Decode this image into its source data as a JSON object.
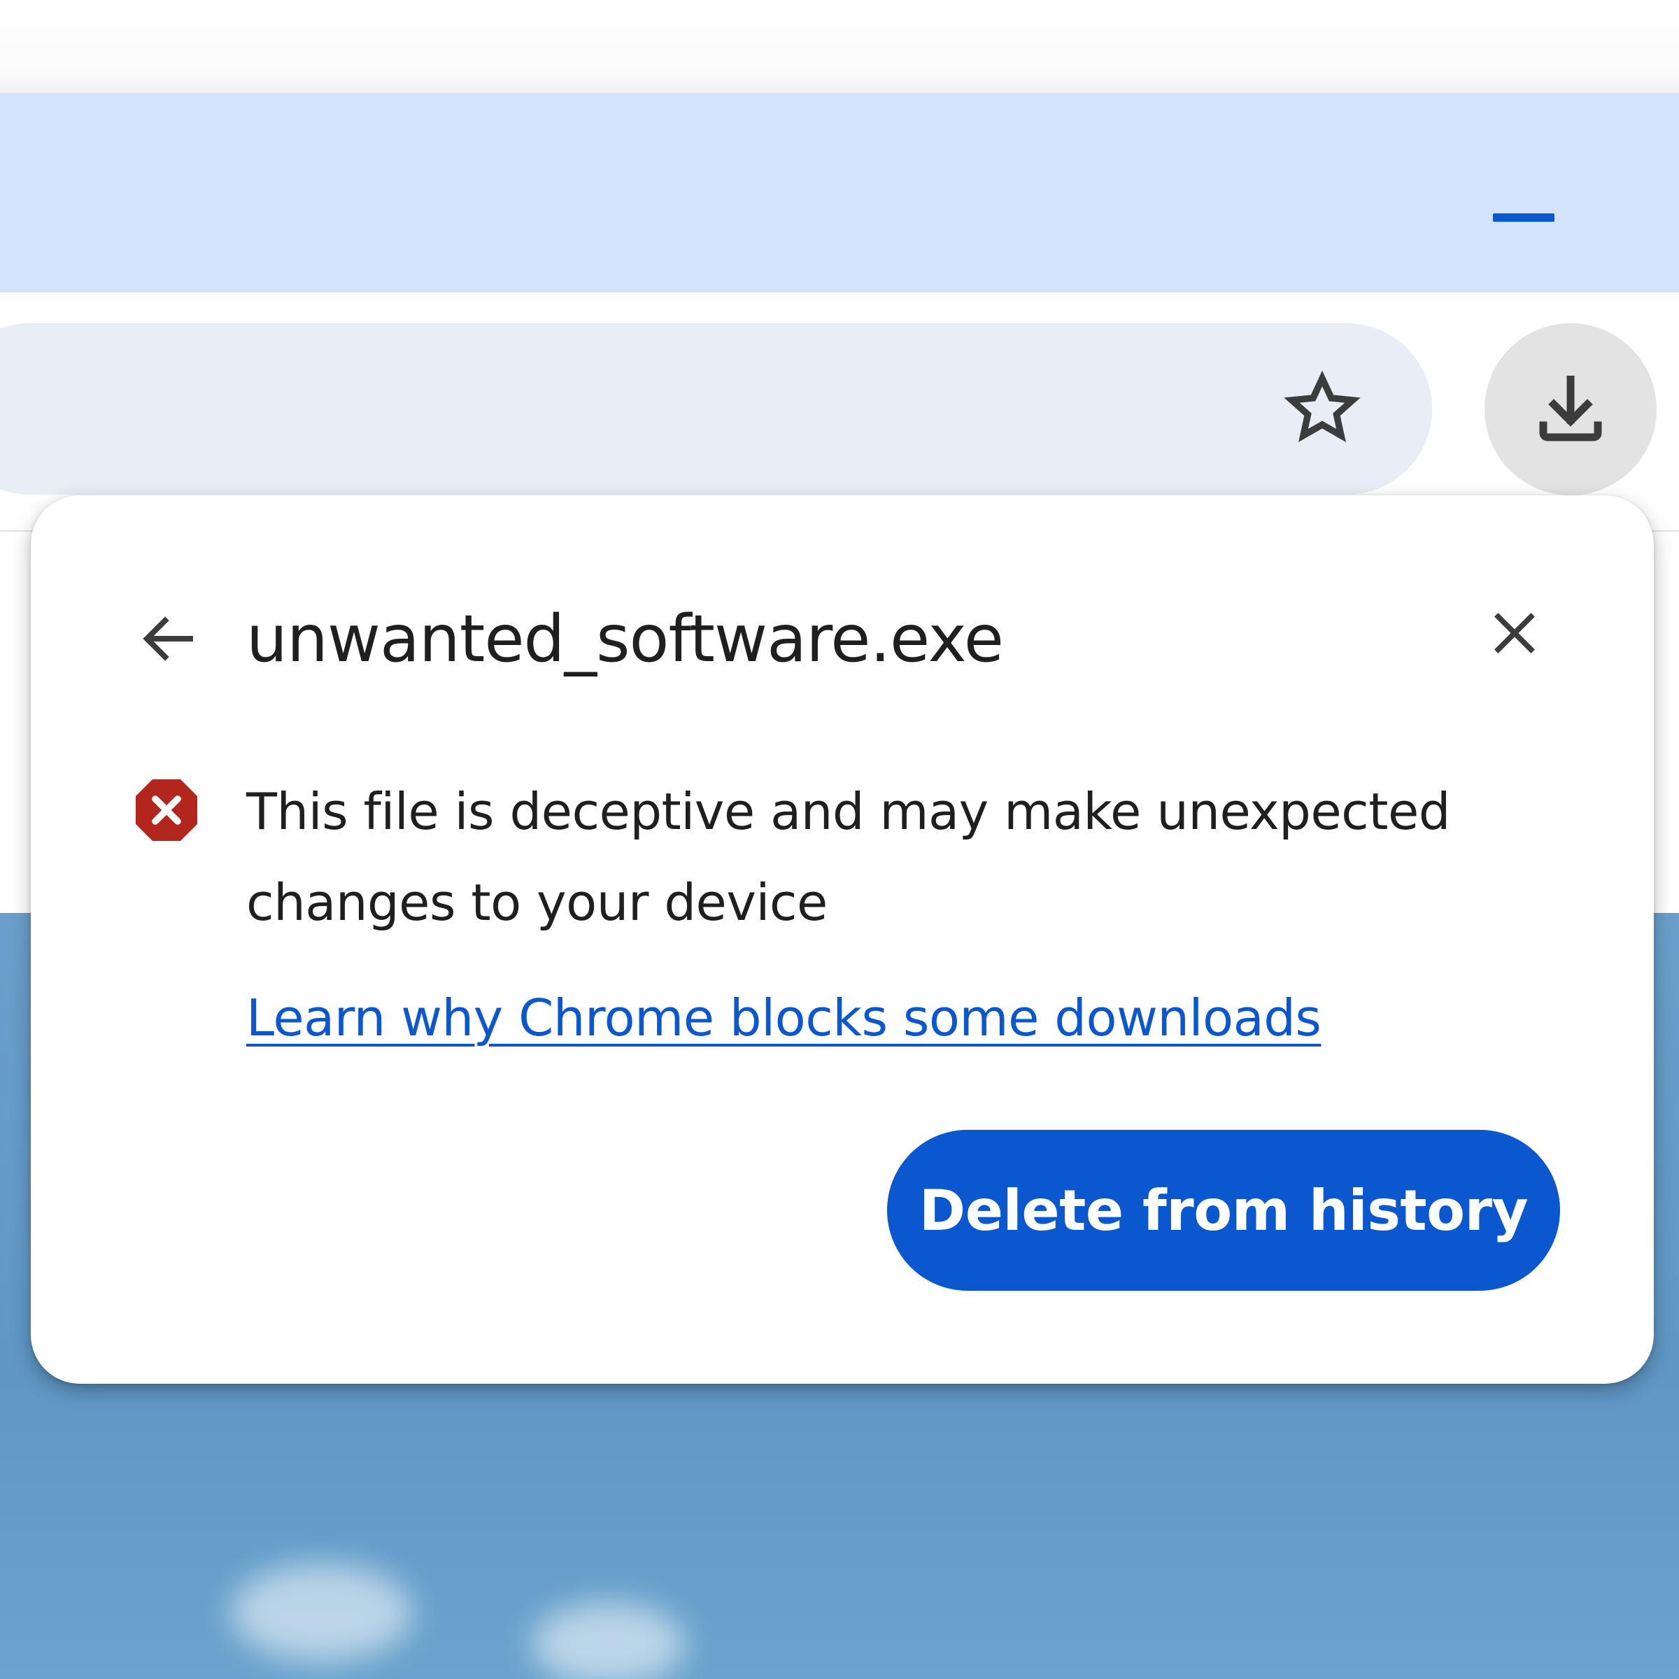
{
  "popup": {
    "filename": "unwanted_software.exe",
    "warning": "This file is deceptive and may make unexpected changes to your device",
    "learn_more_link": "Learn why Chrome blocks some downloads",
    "delete_button": "Delete from history"
  },
  "icons": {
    "minimize": "minimize-icon",
    "bookmark": "star-icon",
    "downloads": "download-icon",
    "back": "arrow-left-icon",
    "close": "close-icon",
    "warning": "error-octagon-icon"
  },
  "colors": {
    "accent": "#0b57d0",
    "tab_strip": "#d3e3fd",
    "omnibox": "#e9eef6",
    "danger": "#b3261e",
    "text": "#1f1f1f"
  }
}
